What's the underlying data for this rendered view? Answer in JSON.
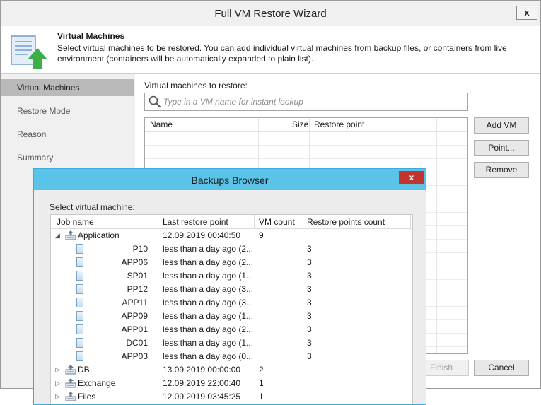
{
  "window": {
    "title": "Full VM Restore Wizard",
    "close_label": "x",
    "header_heading": "Virtual Machines",
    "header_description": "Select virtual machines to be restored. You  can add individual virtual machines from backup files, or containers from live environment (containers will be automatically expanded to plain list)."
  },
  "steps": [
    {
      "label": "Virtual Machines",
      "active": true
    },
    {
      "label": "Restore Mode",
      "active": false
    },
    {
      "label": "Reason",
      "active": false
    },
    {
      "label": "Summary",
      "active": false
    }
  ],
  "main": {
    "list_label": "Virtual machines to restore:",
    "search_placeholder": "Type in a VM name for instant lookup",
    "columns": [
      "Name",
      "Size",
      "Restore point"
    ],
    "buttons": {
      "add_vm": "Add VM",
      "point": "Point...",
      "remove": "Remove"
    }
  },
  "footer": {
    "finish": "Finish",
    "cancel": "Cancel"
  },
  "browser": {
    "title": "Backups Browser",
    "close_label": "x",
    "label": "Select virtual machine:",
    "columns": [
      "Job name",
      "Last restore point",
      "VM count",
      "Restore points count"
    ],
    "rows": [
      {
        "kind": "job",
        "expanded": true,
        "name": "Application",
        "last": "12.09.2019 00:40:50",
        "vm_count": "9",
        "rp_count": ""
      },
      {
        "kind": "vm",
        "name": "P10",
        "last": "less than a day ago (2...",
        "vm_count": "",
        "rp_count": "3"
      },
      {
        "kind": "vm",
        "name": "APP06",
        "last": "less than a day ago (2...",
        "vm_count": "",
        "rp_count": "3"
      },
      {
        "kind": "vm",
        "name": "SP01",
        "last": "less than a day ago (1...",
        "vm_count": "",
        "rp_count": "3"
      },
      {
        "kind": "vm",
        "name": "PP12",
        "last": "less than a day ago (3...",
        "vm_count": "",
        "rp_count": "3"
      },
      {
        "kind": "vm",
        "name": "APP11",
        "last": "less than a day ago (3...",
        "vm_count": "",
        "rp_count": "3"
      },
      {
        "kind": "vm",
        "name": "APP09",
        "last": "less than a day ago (1...",
        "vm_count": "",
        "rp_count": "3"
      },
      {
        "kind": "vm",
        "name": "APP01",
        "last": "less than a day ago (2...",
        "vm_count": "",
        "rp_count": "3"
      },
      {
        "kind": "vm",
        "name": "DC01",
        "last": "less than a day ago (1...",
        "vm_count": "",
        "rp_count": "3"
      },
      {
        "kind": "vm",
        "name": "APP03",
        "last": "less than a day ago (0...",
        "vm_count": "",
        "rp_count": "3"
      },
      {
        "kind": "job",
        "expanded": false,
        "name": "DB",
        "last": "13.09.2019 00:00:00",
        "vm_count": "2",
        "rp_count": ""
      },
      {
        "kind": "job",
        "expanded": false,
        "name": "Exchange",
        "last": "12.09.2019 22:00:40",
        "vm_count": "1",
        "rp_count": ""
      },
      {
        "kind": "job",
        "expanded": false,
        "name": "Files",
        "last": "12.09.2019 03:45:25",
        "vm_count": "1",
        "rp_count": ""
      }
    ]
  },
  "icons": {
    "search": "search-icon",
    "header": "restore-arrow-icon",
    "job": "backup-job-icon",
    "vm": "vm-icon"
  },
  "colors": {
    "browser_titlebar": "#5bc3e8",
    "close_red": "#c1352c",
    "active_step": "#b9b9b9"
  }
}
